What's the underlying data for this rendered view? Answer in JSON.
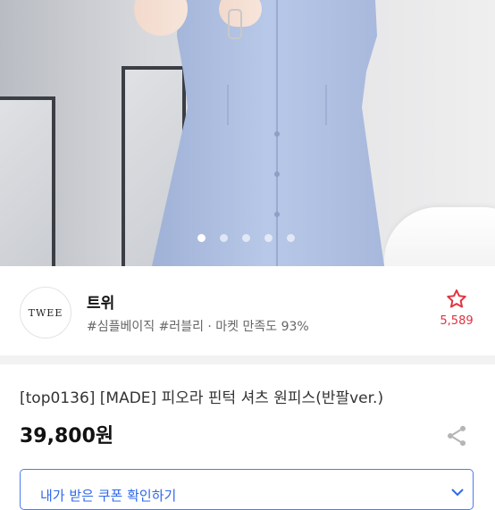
{
  "product_image": {
    "alt": "blue pintuck shirt dress photo",
    "slide_count": 5,
    "active_slide": 1
  },
  "shop": {
    "logo_text": "TWEE",
    "name": "트위",
    "tags": "#심플베이직 #러블리 · 마켓 만족도 93%",
    "favorite_count": "5,589"
  },
  "product": {
    "title": "[top0136] [MADE] 피오라 핀턱 셔츠 원피스(반팔ver.)",
    "price": "39,800원"
  },
  "coupon": {
    "label": "내가 받은 쿠폰 확인하기"
  },
  "colors": {
    "accent_red": "#e0323d",
    "accent_blue": "#2f68ea",
    "dress_blue": "#aebfe0"
  },
  "icons": {
    "favorite": "star-outline-icon",
    "share": "share-icon",
    "coupon_arrow": "chevron-down-icon"
  }
}
